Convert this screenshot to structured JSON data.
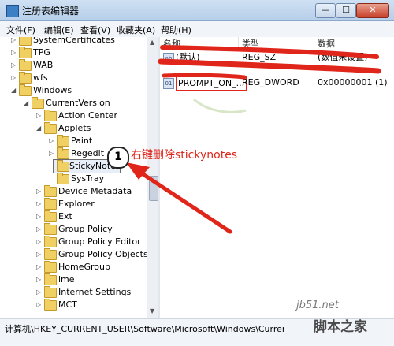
{
  "window": {
    "title": "注册表编辑器",
    "buttons": {
      "minimize": "—",
      "maximize": "☐",
      "close": "✕"
    }
  },
  "menu": [
    "文件(F)",
    "编辑(E)",
    "查看(V)",
    "收藏夹(A)",
    "帮助(H)"
  ],
  "tree": [
    {
      "label": "SystemCertificates",
      "expander": "▷"
    },
    {
      "label": "TPG",
      "expander": "▷"
    },
    {
      "label": "WAB",
      "expander": "▷"
    },
    {
      "label": "wfs",
      "expander": "▷"
    },
    {
      "label": "Windows",
      "expander": "◢"
    },
    {
      "label": "CurrentVersion",
      "expander": "◢"
    },
    {
      "label": "Action Center",
      "expander": "▷"
    },
    {
      "label": "Applets",
      "expander": "◢"
    },
    {
      "label": "Paint",
      "expander": "▷"
    },
    {
      "label": "Regedit",
      "expander": "▷"
    },
    {
      "label": "StickyNotes",
      "expander": ""
    },
    {
      "label": "SysTray",
      "expander": ""
    },
    {
      "label": "Device Metadata",
      "expander": "▷"
    },
    {
      "label": "Explorer",
      "expander": "▷"
    },
    {
      "label": "Ext",
      "expander": "▷"
    },
    {
      "label": "Group Policy",
      "expander": "▷"
    },
    {
      "label": "Group Policy Editor",
      "expander": "▷"
    },
    {
      "label": "Group Policy Objects",
      "expander": "▷"
    },
    {
      "label": "HomeGroup",
      "expander": "▷"
    },
    {
      "label": "ime",
      "expander": "▷"
    },
    {
      "label": "Internet Settings",
      "expander": "▷"
    },
    {
      "label": "MCT",
      "expander": "▷"
    }
  ],
  "columns": {
    "name": "名称",
    "type": "类型",
    "data": "数据"
  },
  "values": [
    {
      "name": "(默认)",
      "type": "REG_SZ",
      "data": "(数值未设置)",
      "icon": "ab"
    },
    {
      "name": "PROMPT_ON_...",
      "type": "REG_DWORD",
      "data": "0x00000001 (1)",
      "icon": "01"
    }
  ],
  "status": {
    "path": "计算机\\HKEY_CURRENT_USER\\Software\\Microsoft\\Windows\\CurrentVersion\\Applets\\StickyNotes"
  },
  "annotation": {
    "number": "1",
    "text": "右键删除stickynotes",
    "color": "#e0261a"
  },
  "watermark": {
    "top": "jb51.net",
    "bottom": "脚本之家"
  },
  "colors": {
    "annotation_red": "#e0261a",
    "folder_yellow": "#f0cf63",
    "titlebar_blue": "#b7cfe9"
  }
}
